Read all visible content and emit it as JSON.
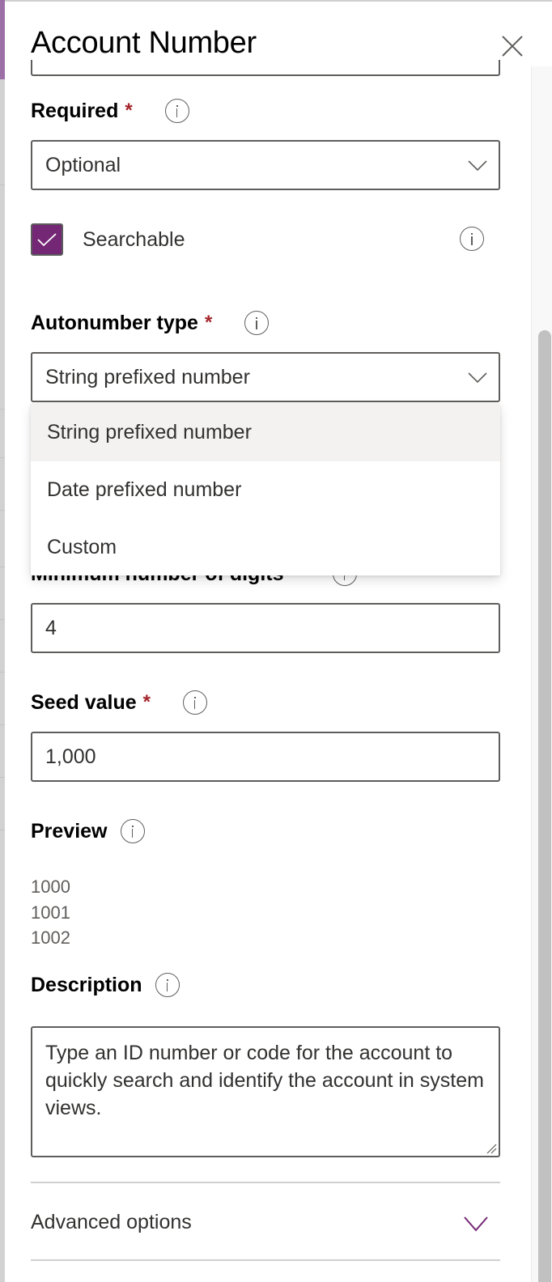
{
  "panel": {
    "title": "Account Number",
    "close_icon": "close-icon"
  },
  "required": {
    "label": "Required",
    "asterisk": "*",
    "value": "Optional"
  },
  "searchable": {
    "label": "Searchable",
    "checked": true
  },
  "autonumber_type": {
    "label": "Autonumber type",
    "asterisk": "*",
    "value": "String prefixed number",
    "options": [
      {
        "label": "String prefixed number",
        "highlighted": true
      },
      {
        "label": "Date prefixed number",
        "highlighted": false
      },
      {
        "label": "Custom",
        "highlighted": false
      }
    ]
  },
  "min_digits": {
    "label": "Minimum number of digits",
    "value": "4"
  },
  "seed_value": {
    "label": "Seed value",
    "asterisk": "*",
    "value": "1,000"
  },
  "preview": {
    "label": "Preview",
    "values": [
      "1000",
      "1001",
      "1002"
    ]
  },
  "description": {
    "label": "Description",
    "value": "Type an ID number or code for the account to quickly search and identify the account in system views."
  },
  "advanced_options": {
    "label": "Advanced options"
  },
  "colors": {
    "accent": "#742774",
    "required_asterisk": "#a4262c",
    "border": "#605e5c",
    "menu_hover": "#f3f2f1"
  }
}
